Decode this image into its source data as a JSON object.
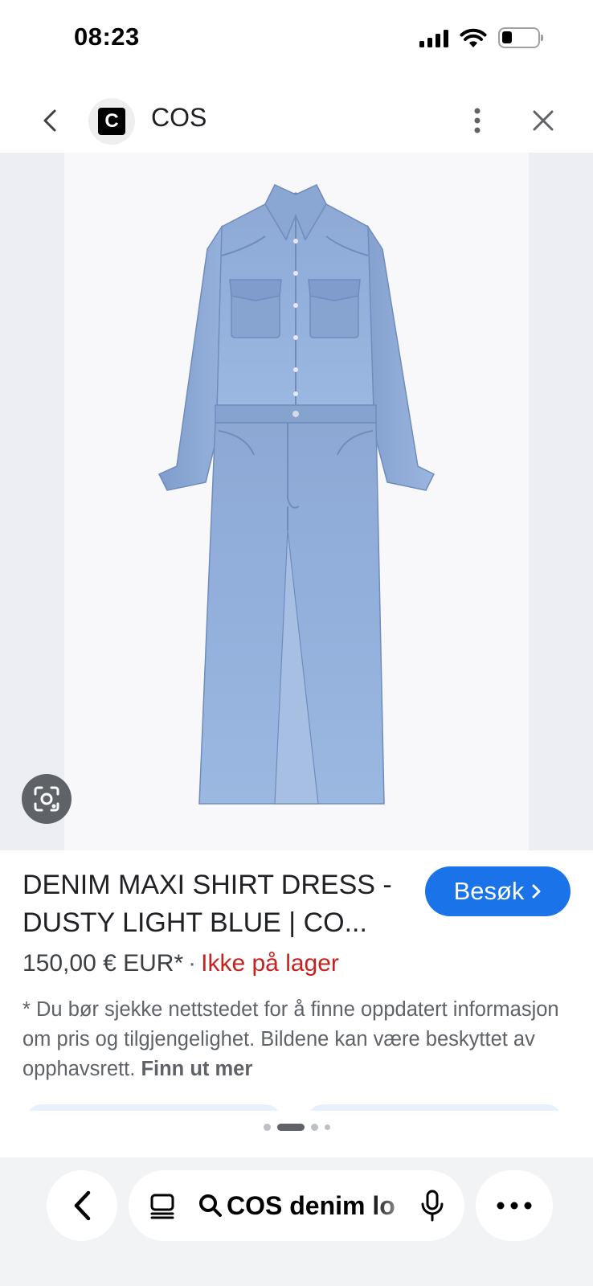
{
  "status_bar": {
    "time": "08:23"
  },
  "header": {
    "site_logo_letter": "C",
    "site_name": "COS"
  },
  "product": {
    "title": "DENIM MAXI SHIRT DRESS - DUSTY LIGHT BLUE | CO...",
    "price": "150,00 € EUR*",
    "separator": "·",
    "stock": "Ikke på lager",
    "visit_label": "Besøk",
    "disclaimer": "* Du bør sjekke nettstedet for å finne oppdatert informasjon om pris og tilgjengelighet. Bildene kan være beskyttet av opphavsrett.",
    "learn_more": "Finn ut mer"
  },
  "bottom_bar": {
    "search_text": "COS denim lo"
  },
  "colors": {
    "accent": "#1a73e8",
    "stock_red": "#c5221f",
    "denim": "#8aaad6"
  },
  "icons": {
    "back": "chevron-left-icon",
    "more": "more-vertical-icon",
    "close": "close-icon",
    "lens": "lens-icon",
    "tabs": "tabs-icon",
    "search": "search-icon",
    "mic": "mic-icon",
    "more_horizontal": "more-horizontal-icon"
  }
}
